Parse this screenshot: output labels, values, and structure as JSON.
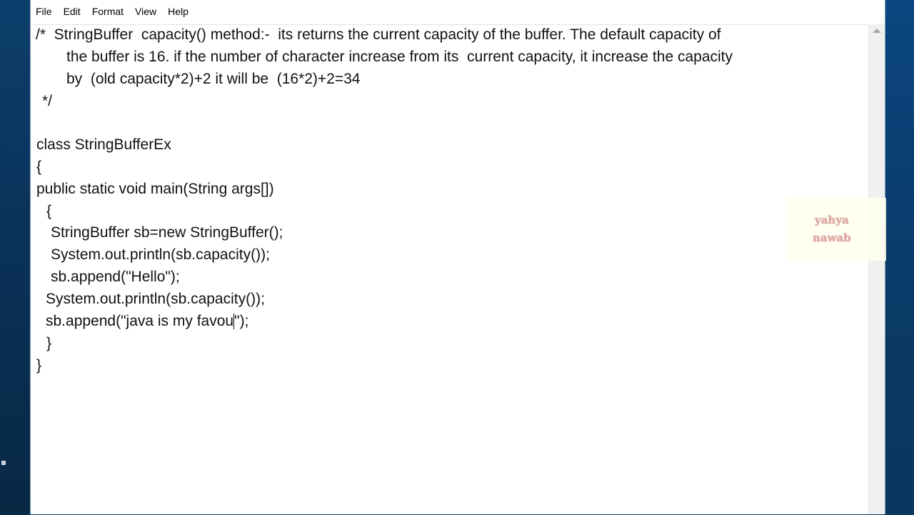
{
  "menu": [
    "File",
    "Edit",
    "Format",
    "View",
    "Help"
  ],
  "code": {
    "l1": "/*  StringBuffer  capacity() method:-  its returns the current capacity of the buffer. The default capacity of",
    "l2": "the buffer is 16. if the number of character increase from its  current capacity, it increase the capacity",
    "l3": "by  (old capacity*2)+2 it will be  (16*2)+2=34",
    "l4": "*/",
    "l5": "class StringBufferEx",
    "l6": "{",
    "l7": "public static void main(String args[])",
    "l8": "{",
    "l9": "StringBuffer sb=new StringBuffer();",
    "l10": "System.out.println(sb.capacity());",
    "l11": "sb.append(\"Hello\");",
    "l12": "System.out.println(sb.capacity());",
    "l13_before": "sb.append(\"java is my favou",
    "l13_after": "\");",
    "l14": "}",
    "l15": "}"
  },
  "watermark": {
    "line1": "yahya",
    "line2": "nawab"
  }
}
